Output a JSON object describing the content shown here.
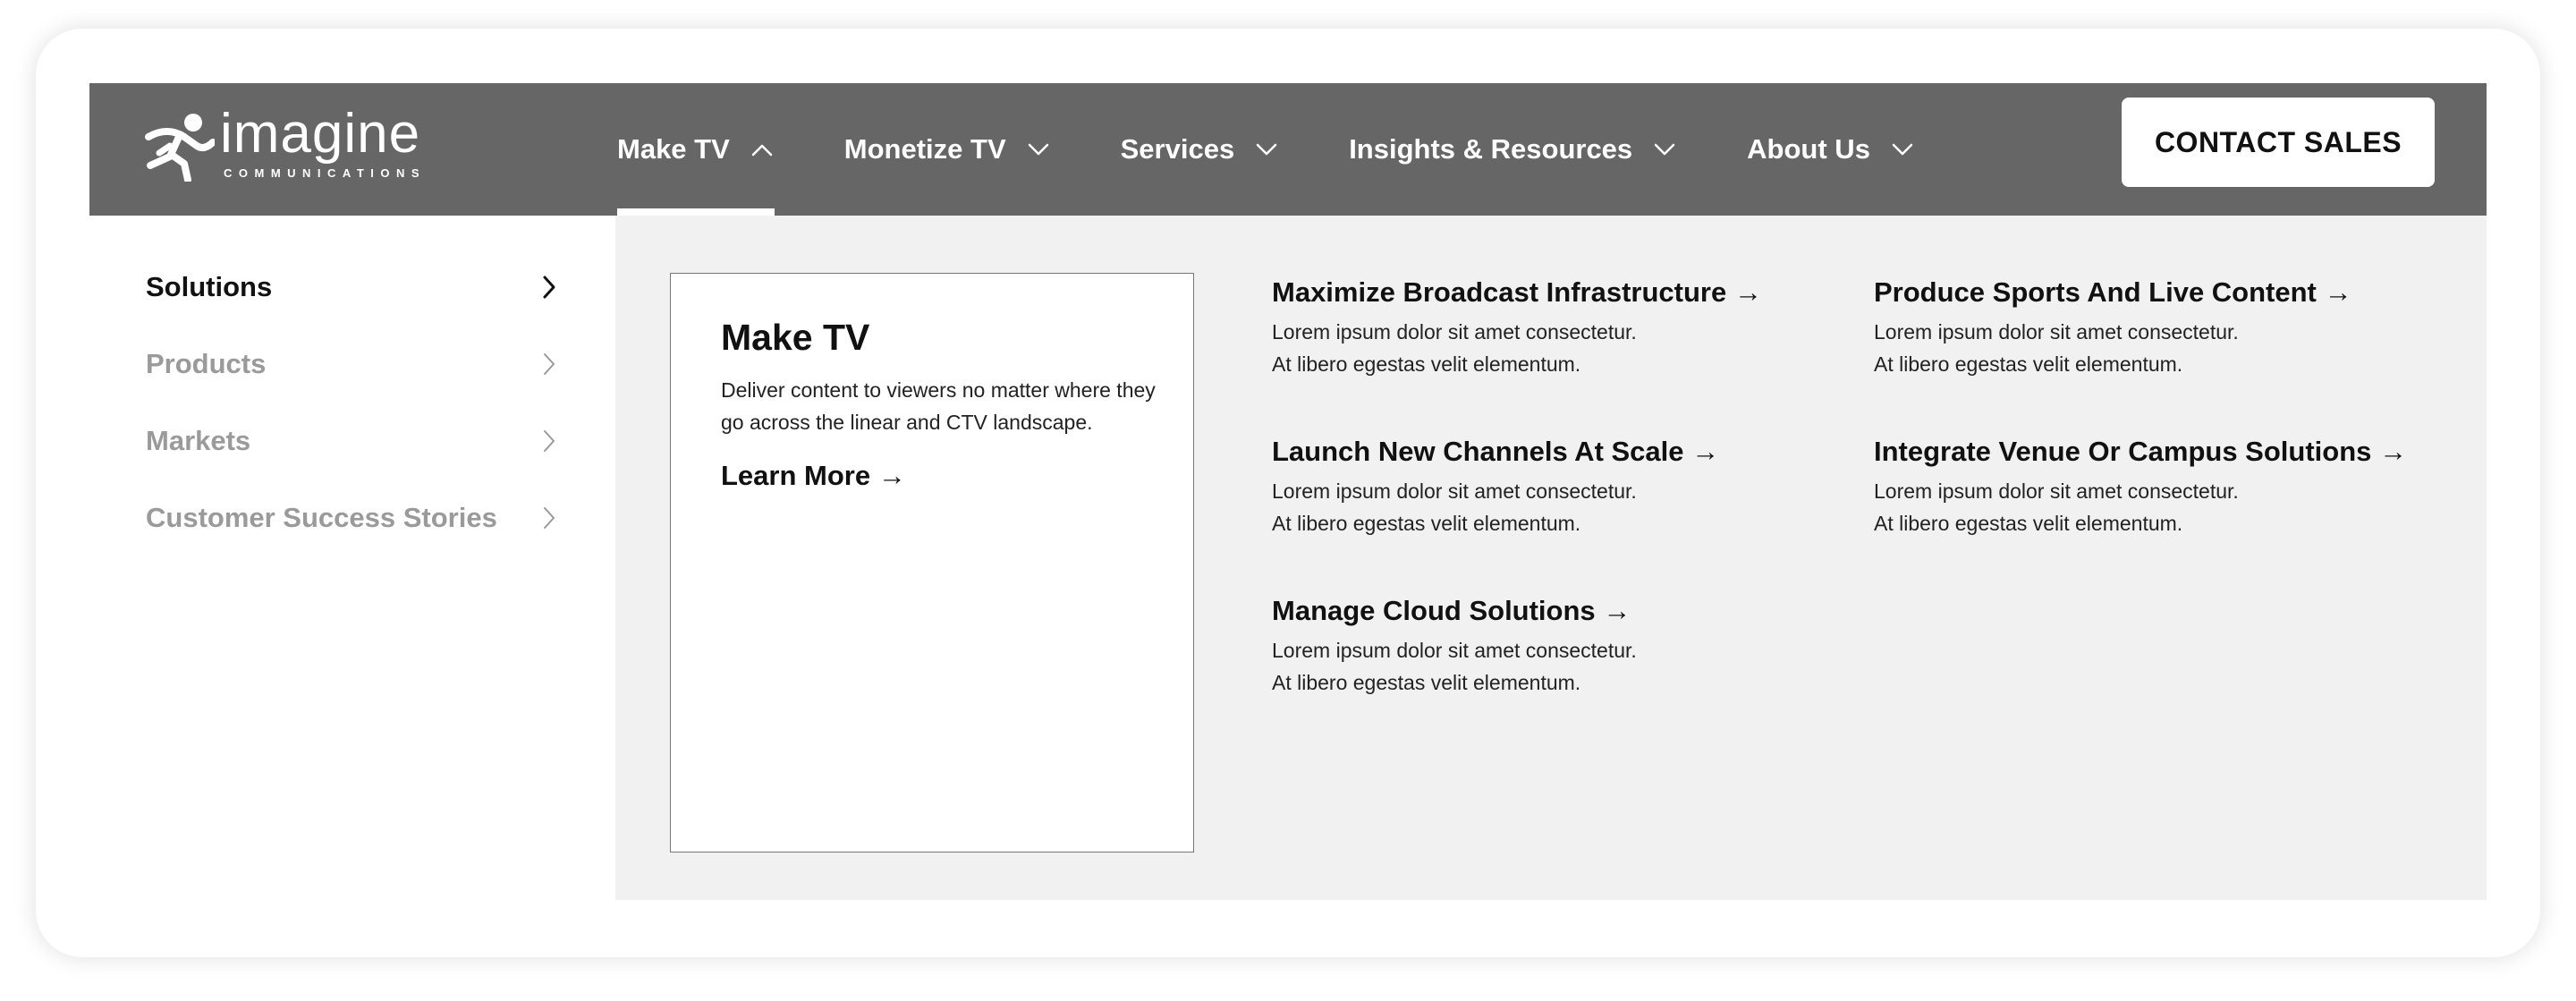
{
  "brand": {
    "name": "imagine",
    "tagline": "COMMUNICATIONS"
  },
  "nav": {
    "items": [
      {
        "label": "Make TV",
        "active": true
      },
      {
        "label": "Monetize TV",
        "active": false
      },
      {
        "label": "Services",
        "active": false
      },
      {
        "label": "Insights & Resources",
        "active": false
      },
      {
        "label": "About Us",
        "active": false
      }
    ],
    "contact_label": "CONTACT SALES"
  },
  "sidebar": {
    "items": [
      {
        "label": "Solutions",
        "active": true
      },
      {
        "label": "Products",
        "active": false
      },
      {
        "label": "Markets",
        "active": false
      },
      {
        "label": "Customer Success Stories",
        "active": false
      }
    ]
  },
  "feature": {
    "title": "Make TV",
    "description": "Deliver content to viewers no matter where they go across the linear and CTV landscape.",
    "link_label": "Learn More →"
  },
  "links": [
    {
      "title": "Maximize Broadcast Infrastructure →",
      "description": "Lorem ipsum dolor sit amet consectetur.\nAt libero egestas velit elementum."
    },
    {
      "title": "Launch New Channels At Scale →",
      "description": "Lorem ipsum dolor sit amet consectetur.\nAt libero egestas velit elementum."
    },
    {
      "title": "Manage Cloud Solutions →",
      "description": "Lorem ipsum dolor sit amet consectetur.\nAt libero egestas velit elementum."
    },
    {
      "title": "Produce Sports And Live Content →",
      "description": "Lorem ipsum dolor sit amet consectetur.\nAt libero egestas velit elementum."
    },
    {
      "title": "Integrate Venue Or Campus Solutions →",
      "description": "Lorem ipsum dolor sit amet consectetur.\nAt libero egestas velit elementum."
    }
  ],
  "colors": {
    "navbar_bg": "#666666",
    "panel_bg": "#f1f1f1",
    "text_primary": "#111111",
    "text_muted": "#9a9a9a"
  },
  "icons": {
    "logo": "running-figure-logo-icon",
    "nav_chevron": "chevron-down-icon",
    "nav_chevron_open": "chevron-up-icon",
    "side_chevron": "chevron-right-icon"
  }
}
